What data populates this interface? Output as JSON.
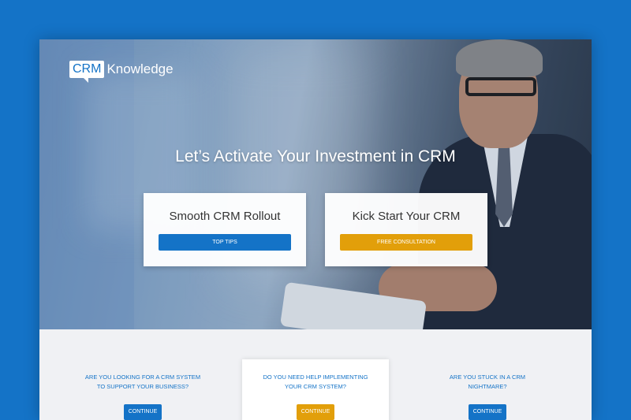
{
  "logo": {
    "box": "CRM",
    "text": "Knowledge"
  },
  "hero": {
    "headline": "Let’s Activate Your Investment in CRM"
  },
  "cards": [
    {
      "title": "Smooth CRM Rollout",
      "button": "TOP TIPS"
    },
    {
      "title": "Kick Start Your CRM",
      "button": "FREE CONSULTATION"
    }
  ],
  "questions": [
    {
      "line1": "ARE YOU LOOKING FOR A CRM SYSTEM",
      "line2": "TO SUPPORT YOUR BUSINESS?",
      "button": "CONTINUE"
    },
    {
      "line1": "DO YOU NEED HELP IMPLEMENTING",
      "line2": "YOUR CRM SYSTEM?",
      "button": "CONTINUE"
    },
    {
      "line1": "ARE YOU STUCK IN A CRM",
      "line2": "NIGHTMARE?",
      "button": "CONTINUE"
    }
  ],
  "colors": {
    "brand": "#1473c7",
    "accent": "#e29f0a"
  }
}
